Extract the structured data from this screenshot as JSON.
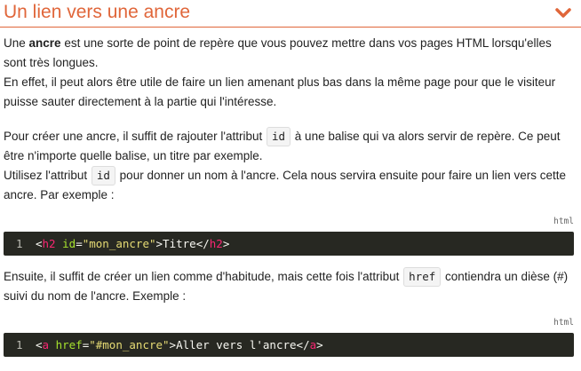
{
  "section": {
    "title": "Un lien vers une ancre",
    "collapse_icon": "chevron-down-icon",
    "accent_color": "#e0663a"
  },
  "p1": {
    "t1": "Une ",
    "bold": "ancre",
    "t2": " est une sorte de point de repère que vous pouvez mettre dans vos pages HTML lorsqu'elles sont très longues.",
    "t3": "En effet, il peut alors être utile de faire un lien amenant plus bas dans la même page pour que le visiteur puisse sauter directement à la partie qui l'intéresse."
  },
  "p2": {
    "t1": "Pour créer une ancre, il suffit de rajouter l'attribut ",
    "code1": "id",
    "t2": " à une balise qui va alors servir de repère. Ce peut être n'importe quelle balise, un titre par exemple.",
    "t3": "Utilisez l'attribut ",
    "code2": "id",
    "t4": " pour donner un nom à l'ancre. Cela nous servira ensuite pour faire un lien vers cette ancre. Par exemple :"
  },
  "code1": {
    "lang": "html",
    "line_number": "1",
    "open_bracket": "<",
    "tag": "h2",
    "space": " ",
    "attr": "id",
    "equals": "=",
    "value": "\"mon_ancre\"",
    "close_bracket": ">",
    "text": "Titre",
    "end_open": "</",
    "end_tag": "h2",
    "end_close": ">"
  },
  "p3": {
    "t1": "Ensuite, il suffit de créer un lien comme d'habitude, mais cette fois l'attribut ",
    "code": "href",
    "t2": " contiendra un dièse (#) suivi du nom de l'ancre. Exemple :"
  },
  "code2": {
    "lang": "html",
    "line_number": "1",
    "open_bracket": "<",
    "tag": "a",
    "space": " ",
    "attr": "href",
    "equals": "=",
    "value": "\"#mon_ancre\"",
    "close_bracket": ">",
    "text": "Aller vers l'ancre",
    "end_open": "</",
    "end_tag": "a",
    "end_close": ">"
  }
}
